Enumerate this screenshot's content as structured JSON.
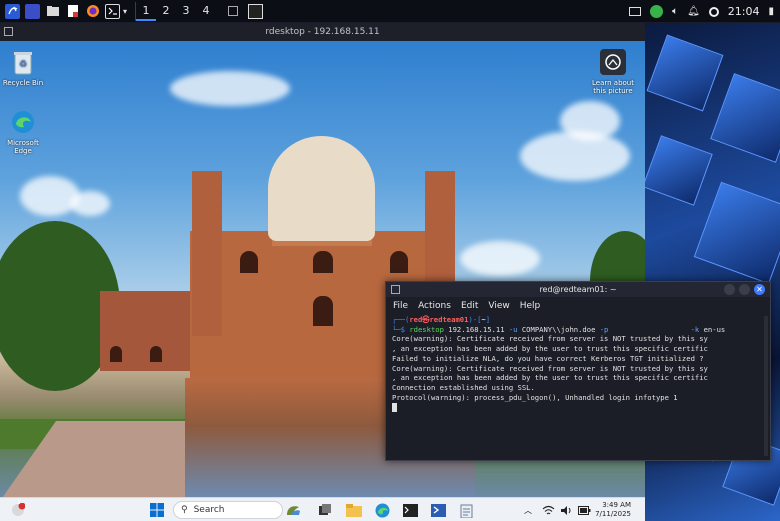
{
  "kali_panel": {
    "workspaces": [
      "1",
      "2",
      "3",
      "4"
    ],
    "active_workspace": "1",
    "clock": "21:04"
  },
  "rdesktop": {
    "title": "rdesktop - 192.168.15.11"
  },
  "desktop_icons": [
    {
      "label": "Recycle Bin",
      "icon": "recycle-bin-icon"
    },
    {
      "label": "Microsoft Edge",
      "icon": "edge-icon"
    },
    {
      "label": "Learn about this picture",
      "icon": "learn-picture-icon"
    }
  ],
  "windows_taskbar": {
    "search_placeholder": "Search",
    "time": "3:49 AM",
    "date": "7/11/2025",
    "notification_count": "1"
  },
  "terminal": {
    "title": "red@redteam01: ~",
    "menu": [
      "File",
      "Actions",
      "Edit",
      "View",
      "Help"
    ],
    "prompt_open": "┌──(",
    "prompt_user": "red㉿redteam01",
    "prompt_close": ")-[",
    "prompt_dir": "~",
    "prompt_end": "]",
    "cmd_prefix": "└─$ ",
    "cmd_name": "rdesktop",
    "cmd_ip": " 192.168.15.11 ",
    "cmd_u": "-u",
    "cmd_user": " COMPANY\\\\john.doe ",
    "cmd_p": "-p",
    "cmd_gap": "                   ",
    "cmd_k": "-k",
    "cmd_lang": " en-us",
    "output": [
      "Core(warning): Certificate received from server is NOT trusted by this sy",
      ", an exception has been added by the user to trust this specific certific",
      "Failed to initialize NLA, do you have correct Kerberos TGT initialized ?",
      "Core(warning): Certificate received from server is NOT trusted by this sy",
      ", an exception has been added by the user to trust this specific certific",
      "Connection established using SSL.",
      "Protocol(warning): process_pdu_logon(), Unhandled login infotype 1"
    ]
  }
}
